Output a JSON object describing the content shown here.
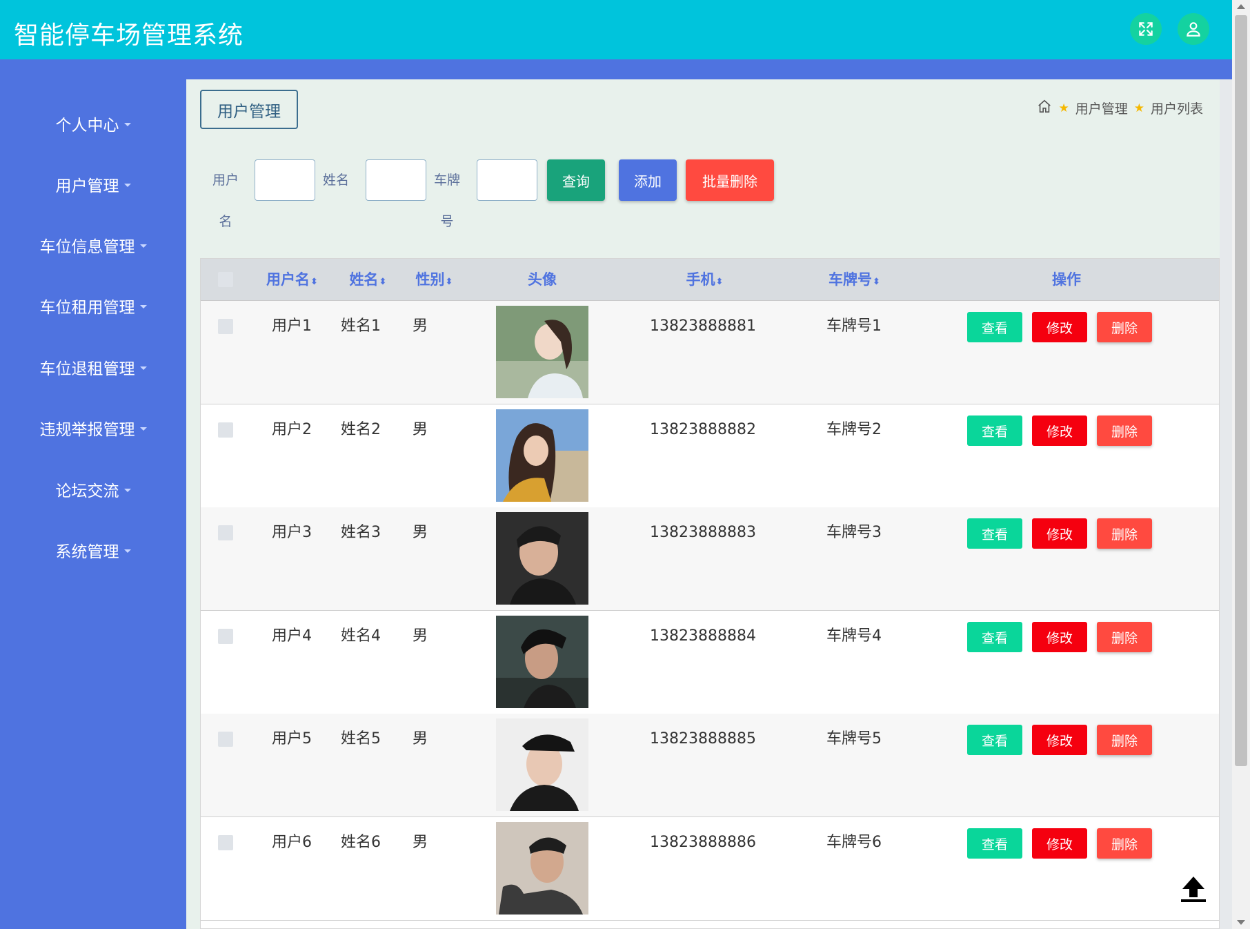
{
  "app": {
    "title": "智能停车场管理系统"
  },
  "header": {
    "fullscreen_icon": "fullscreen-icon",
    "user_icon": "user-icon"
  },
  "sidebar": {
    "items": [
      {
        "label": "个人中心"
      },
      {
        "label": "用户管理"
      },
      {
        "label": "车位信息管理"
      },
      {
        "label": "车位租用管理"
      },
      {
        "label": "车位退租管理"
      },
      {
        "label": "违规举报管理"
      },
      {
        "label": "论坛交流"
      },
      {
        "label": "系统管理"
      }
    ]
  },
  "page": {
    "tab_label": "用户管理",
    "breadcrumb": [
      "用户管理",
      "用户列表"
    ]
  },
  "search": {
    "username_label_1": "用户",
    "username_label_2": "名",
    "name_label": "姓名",
    "plate_label_1": "车牌",
    "plate_label_2": "号",
    "username_value": "",
    "name_value": "",
    "plate_value": "",
    "query_button": "查询",
    "add_button": "添加",
    "batch_delete_button": "批量删除"
  },
  "table": {
    "columns": [
      "用户名",
      "姓名",
      "性别",
      "头像",
      "手机",
      "车牌号",
      "操作"
    ],
    "sort_glyph": "⬍",
    "rows": [
      {
        "username": "用户1",
        "name": "姓名1",
        "gender": "男",
        "phone": "13823888881",
        "plate": "车牌号1"
      },
      {
        "username": "用户2",
        "name": "姓名2",
        "gender": "男",
        "phone": "13823888882",
        "plate": "车牌号2"
      },
      {
        "username": "用户3",
        "name": "姓名3",
        "gender": "男",
        "phone": "13823888883",
        "plate": "车牌号3"
      },
      {
        "username": "用户4",
        "name": "姓名4",
        "gender": "男",
        "phone": "13823888884",
        "plate": "车牌号4"
      },
      {
        "username": "用户5",
        "name": "姓名5",
        "gender": "男",
        "phone": "13823888885",
        "plate": "车牌号5"
      },
      {
        "username": "用户6",
        "name": "姓名6",
        "gender": "男",
        "phone": "13823888886",
        "plate": "车牌号6"
      }
    ],
    "actions": {
      "view": "查看",
      "edit": "修改",
      "delete": "删除"
    }
  },
  "colors": {
    "topbar": "#00c4dc",
    "sidebar": "#4f73e0",
    "main_bg": "#e8f1ec",
    "query_button": "#19a37b",
    "add_button": "#4f73e0",
    "batch_delete_button": "#ff4a40",
    "view_button": "#0ad69a",
    "edit_button": "#f5000f",
    "delete_button": "#ff4a40"
  }
}
